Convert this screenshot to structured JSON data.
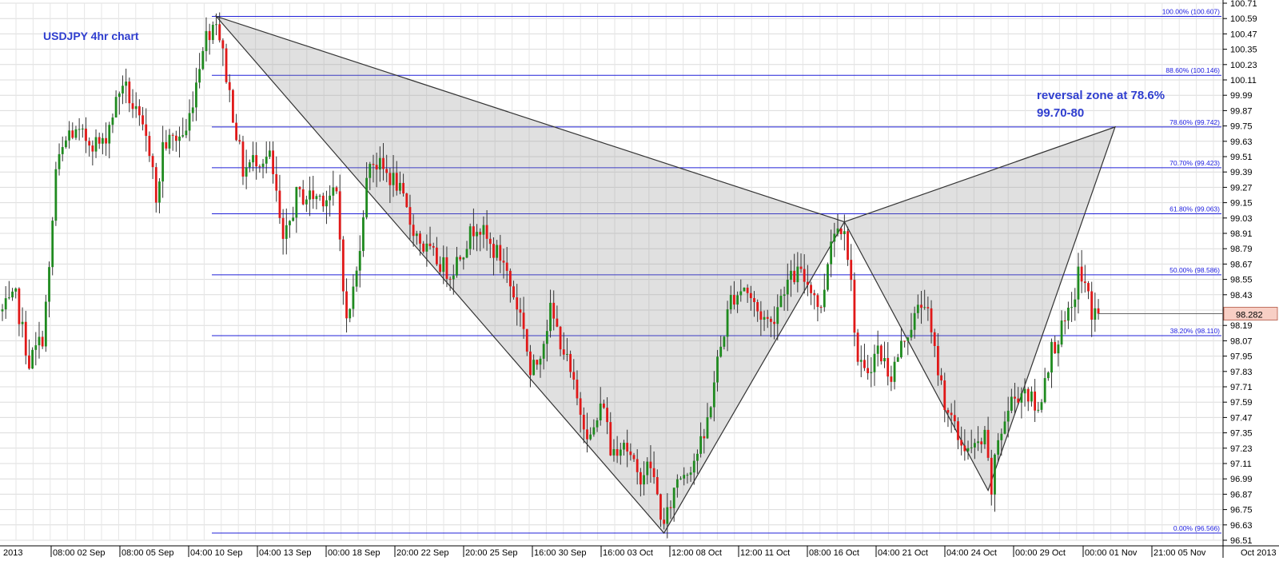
{
  "chart_data": {
    "type": "candlestick",
    "title": "USDJPY 4hr chart",
    "ylim": [
      96.51,
      100.71
    ],
    "grid": true,
    "y_ticks": [
      "100.71",
      "100.59",
      "100.47",
      "100.35",
      "100.23",
      "100.11",
      "99.99",
      "99.87",
      "99.75",
      "99.63",
      "99.51",
      "99.39",
      "99.27",
      "99.15",
      "99.03",
      "98.91",
      "98.79",
      "98.67",
      "98.55",
      "98.43",
      "98.31",
      "98.19",
      "98.07",
      "97.95",
      "97.83",
      "97.71",
      "97.59",
      "97.47",
      "97.35",
      "97.23",
      "97.11",
      "96.99",
      "96.87",
      "96.75",
      "96.63",
      "96.51"
    ],
    "x_ticks": [
      "2013",
      "08:00 02 Sep",
      "08:00 05 Sep",
      "04:00 10 Sep",
      "04:00 13 Sep",
      "00:00 18 Sep",
      "20:00 22 Sep",
      "20:00 25 Sep",
      "16:00 30 Sep",
      "16:00 03 Oct",
      "12:00 08 Oct",
      "12:00 11 Oct",
      "08:00 16 Oct",
      "04:00 21 Oct",
      "04:00 24 Oct",
      "00:00 29 Oct",
      "00:00 01 Nov",
      "21:00 05 Nov",
      "Oct 2013"
    ],
    "current_price": "98.282",
    "fib_levels": [
      {
        "label": "100.00% (100.607)",
        "value": 100.607
      },
      {
        "label": "88.60% (100.146)",
        "value": 100.146
      },
      {
        "label": "78.60% (99.742)",
        "value": 99.742
      },
      {
        "label": "70.70% (99.423)",
        "value": 99.423
      },
      {
        "label": "61.80% (99.063)",
        "value": 99.063
      },
      {
        "label": "50.00% (98.586)",
        "value": 98.586
      },
      {
        "label": "38.20% (98.110)",
        "value": 98.11
      },
      {
        "label": "0.00% (96.566)",
        "value": 96.566
      }
    ],
    "pattern_points": [
      {
        "bar": 64,
        "price": 100.607
      },
      {
        "bar": 198,
        "price": 96.566
      },
      {
        "bar": 252,
        "price": 99.0
      },
      {
        "bar": 295,
        "price": 96.9
      },
      {
        "bar": 333,
        "price": 99.742
      }
    ],
    "annotation": {
      "line1": "reversal zone at 78.6%",
      "line2": "99.70-80"
    },
    "price_path": [
      [
        0,
        98.3
      ],
      [
        4,
        98.4
      ],
      [
        8,
        97.9
      ],
      [
        12,
        98.1
      ],
      [
        14,
        98.6
      ],
      [
        16,
        99.4
      ],
      [
        20,
        99.7
      ],
      [
        30,
        99.6
      ],
      [
        36,
        100.1
      ],
      [
        42,
        99.7
      ],
      [
        45,
        99.5
      ],
      [
        46,
        99.1
      ],
      [
        48,
        99.6
      ],
      [
        55,
        99.7
      ],
      [
        58,
        100.1
      ],
      [
        60,
        100.4
      ],
      [
        64,
        100.6
      ],
      [
        68,
        100.0
      ],
      [
        72,
        99.4
      ],
      [
        76,
        99.5
      ],
      [
        80,
        99.5
      ],
      [
        82,
        99.2
      ],
      [
        84,
        98.8
      ],
      [
        88,
        99.2
      ],
      [
        92,
        99.2
      ],
      [
        100,
        99.2
      ],
      [
        103,
        98.2
      ],
      [
        106,
        98.6
      ],
      [
        108,
        99.1
      ],
      [
        110,
        99.5
      ],
      [
        114,
        99.4
      ],
      [
        118,
        99.3
      ],
      [
        122,
        99.0
      ],
      [
        126,
        98.8
      ],
      [
        130,
        98.7
      ],
      [
        134,
        98.6
      ],
      [
        138,
        98.8
      ],
      [
        142,
        99.0
      ],
      [
        146,
        98.8
      ],
      [
        150,
        98.7
      ],
      [
        152,
        98.5
      ],
      [
        156,
        98.2
      ],
      [
        158,
        97.8
      ],
      [
        160,
        97.9
      ],
      [
        164,
        98.3
      ],
      [
        168,
        98.0
      ],
      [
        172,
        97.6
      ],
      [
        176,
        97.3
      ],
      [
        180,
        97.6
      ],
      [
        182,
        97.2
      ],
      [
        186,
        97.3
      ],
      [
        190,
        97.0
      ],
      [
        194,
        97.1
      ],
      [
        198,
        96.6
      ],
      [
        202,
        97.0
      ],
      [
        206,
        97.1
      ],
      [
        210,
        97.3
      ],
      [
        212,
        97.6
      ],
      [
        214,
        97.9
      ],
      [
        218,
        98.4
      ],
      [
        222,
        98.5
      ],
      [
        226,
        98.3
      ],
      [
        230,
        98.2
      ],
      [
        234,
        98.5
      ],
      [
        238,
        98.6
      ],
      [
        242,
        98.5
      ],
      [
        245,
        98.3
      ],
      [
        248,
        98.9
      ],
      [
        252,
        99.0
      ],
      [
        254,
        98.5
      ],
      [
        256,
        97.9
      ],
      [
        258,
        97.8
      ],
      [
        262,
        98.0
      ],
      [
        266,
        97.8
      ],
      [
        270,
        98.1
      ],
      [
        274,
        98.3
      ],
      [
        276,
        98.4
      ],
      [
        278,
        98.1
      ],
      [
        282,
        97.6
      ],
      [
        286,
        97.3
      ],
      [
        290,
        97.2
      ],
      [
        294,
        97.3
      ],
      [
        296,
        96.9
      ],
      [
        298,
        97.3
      ],
      [
        302,
        97.6
      ],
      [
        306,
        97.7
      ],
      [
        310,
        97.5
      ],
      [
        312,
        97.8
      ],
      [
        314,
        98.0
      ],
      [
        318,
        98.2
      ],
      [
        320,
        98.3
      ],
      [
        322,
        98.6
      ],
      [
        324,
        98.5
      ],
      [
        326,
        98.3
      ],
      [
        328,
        98.282
      ]
    ]
  }
}
